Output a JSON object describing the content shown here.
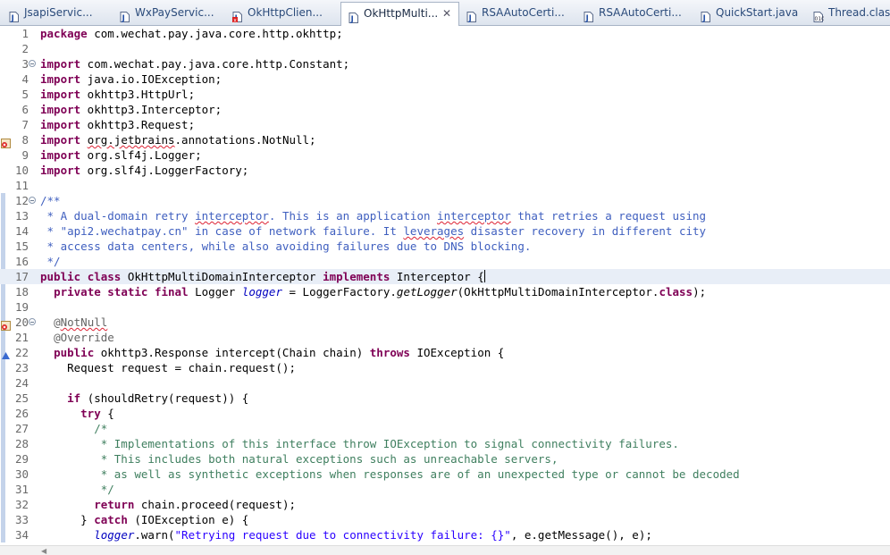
{
  "tabs": [
    {
      "label": "JsapiServic...",
      "icon": "java-file-icon",
      "active": false
    },
    {
      "label": "WxPayServic...",
      "icon": "java-file-icon",
      "active": false
    },
    {
      "label": "OkHttpClien...",
      "icon": "java-file-error-icon",
      "active": false
    },
    {
      "label": "OkHttpMulti...",
      "icon": "java-file-icon",
      "active": true,
      "close": "✕"
    },
    {
      "label": "RSAAutoCerti...",
      "icon": "java-file-icon",
      "active": false
    },
    {
      "label": "RSAAutoCerti...",
      "icon": "java-file-icon",
      "active": false
    },
    {
      "label": "QuickStart.java",
      "icon": "java-file-icon",
      "active": false
    },
    {
      "label": "Thread.class",
      "icon": "class-file-icon",
      "active": false
    }
  ],
  "editor": {
    "current_line": 17,
    "lines": [
      {
        "n": "1",
        "code": "<span class=\"k\">package</span> com.wechat.pay.java.core.http.okhttp;"
      },
      {
        "n": "2",
        "code": ""
      },
      {
        "n": "3",
        "fold": true,
        "code": "<span class=\"k\">import</span> com.wechat.pay.java.core.http.Constant;"
      },
      {
        "n": "4",
        "code": "<span class=\"k\">import</span> java.io.IOException;"
      },
      {
        "n": "5",
        "code": "<span class=\"k\">import</span> okhttp3.HttpUrl;"
      },
      {
        "n": "6",
        "code": "<span class=\"k\">import</span> okhttp3.Interceptor;"
      },
      {
        "n": "7",
        "code": "<span class=\"k\">import</span> okhttp3.Request;"
      },
      {
        "n": "8",
        "marker": "error",
        "code": "<span class=\"k\">import</span> <span class=\"sq\">org.jetbrains</span>.annotations.NotNull;"
      },
      {
        "n": "9",
        "code": "<span class=\"k\">import</span> org.slf4j.Logger;"
      },
      {
        "n": "10",
        "code": "<span class=\"k\">import</span> org.slf4j.LoggerFactory;"
      },
      {
        "n": "11",
        "code": ""
      },
      {
        "n": "12",
        "fold": true,
        "code": "<span class=\"jd\">/**</span>"
      },
      {
        "n": "13",
        "code": "<span class=\"jd\"> * A dual-domain retry <span class=\"sq\">interceptor</span>. This is an application <span class=\"sq\">interceptor</span> that retries a request using</span>"
      },
      {
        "n": "14",
        "code": "<span class=\"jd\"> * \"api2.wechatpay.cn\" in case of network failure. It <span class=\"sq\">leverages</span> disaster recovery in different city</span>"
      },
      {
        "n": "15",
        "code": "<span class=\"jd\"> * access data centers, while also avoiding failures due to DNS blocking.</span>"
      },
      {
        "n": "16",
        "code": "<span class=\"jd\"> */</span>"
      },
      {
        "n": "17",
        "code": "<span class=\"k\">public</span> <span class=\"k\">class</span> OkHttpMultiDomainInterceptor <span class=\"k\">implements</span> Interceptor {<span class=\"caret\"></span>"
      },
      {
        "n": "18",
        "code": "  <span class=\"k\">private</span> <span class=\"k\">static</span> <span class=\"k\">final</span> Logger <span class=\"fi\">logger</span> = LoggerFactory.<span class=\"it\">getLogger</span>(OkHttpMultiDomainInterceptor.<span class=\"k\">class</span>);"
      },
      {
        "n": "19",
        "code": ""
      },
      {
        "n": "20",
        "fold": true,
        "marker": "error",
        "code": "  <span class=\"an\">@<span class=\"sq\">NotNull</span></span>"
      },
      {
        "n": "21",
        "code": "  <span class=\"an\">@Override</span>"
      },
      {
        "n": "22",
        "marker": "override",
        "code": "  <span class=\"k\">public</span> okhttp3.Response intercept(Chain chain) <span class=\"k\">throws</span> IOException {"
      },
      {
        "n": "23",
        "code": "    Request request = chain.request();"
      },
      {
        "n": "24",
        "code": ""
      },
      {
        "n": "25",
        "code": "    <span class=\"k\">if</span> (shouldRetry(request)) {"
      },
      {
        "n": "26",
        "code": "      <span class=\"k\">try</span> {"
      },
      {
        "n": "27",
        "code": "        <span class=\"c\">/*</span>"
      },
      {
        "n": "28",
        "code": "<span class=\"c\">         * Implementations of this interface throw IOException to signal connectivity failures.</span>"
      },
      {
        "n": "29",
        "code": "<span class=\"c\">         * This includes both natural exceptions such as unreachable servers,</span>"
      },
      {
        "n": "30",
        "code": "<span class=\"c\">         * as well as synthetic exceptions when responses are of an unexpected type or cannot be decoded</span>"
      },
      {
        "n": "31",
        "code": "<span class=\"c\">         */</span>"
      },
      {
        "n": "32",
        "code": "        <span class=\"k\">return</span> chain.proceed(request);"
      },
      {
        "n": "33",
        "code": "      } <span class=\"k\">catch</span> (IOException e) {"
      },
      {
        "n": "34",
        "code": "        <span class=\"fi\">logger</span>.warn(<span class=\"s\">\"Retrying request due to connectivity failure: {}\"</span>, e.getMessage(), e);"
      }
    ]
  }
}
